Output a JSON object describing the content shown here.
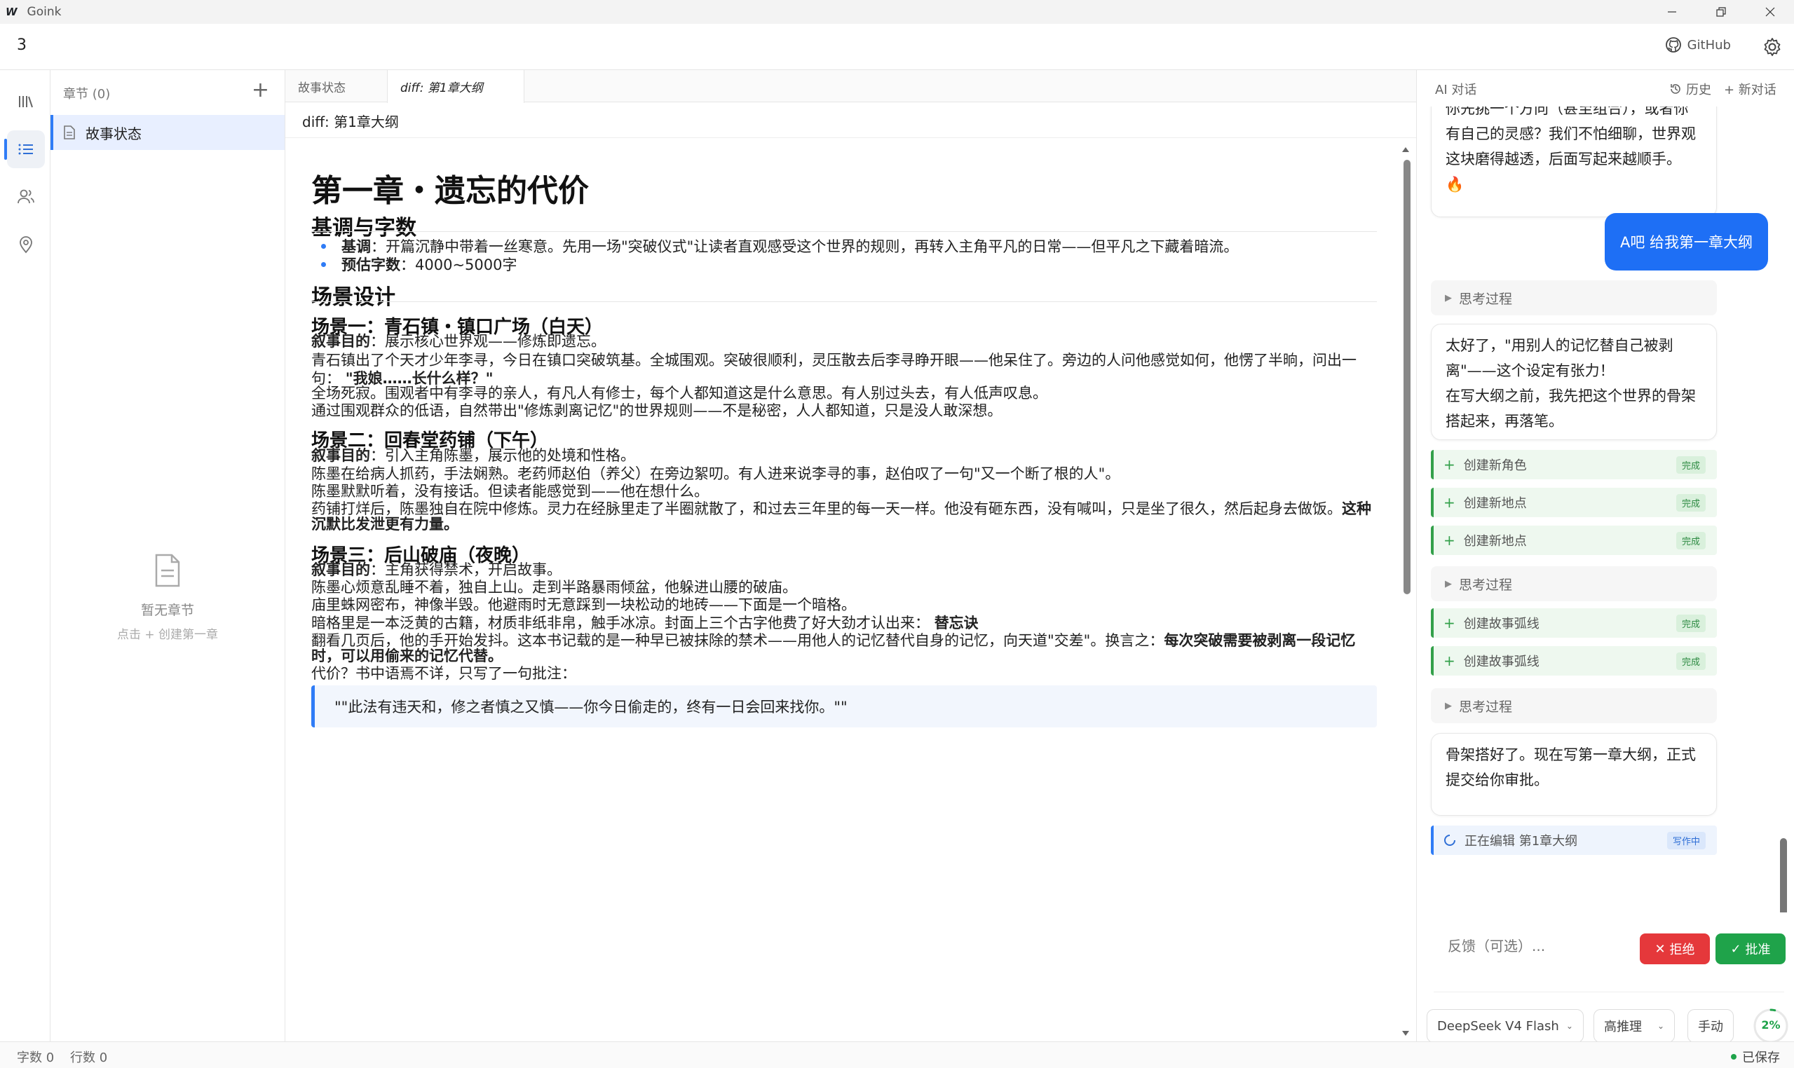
{
  "window": {
    "logo": "W",
    "title": "Goink"
  },
  "topbar": {
    "project": "3",
    "github_label": "GitHub"
  },
  "rail": {
    "items": [
      "library-icon",
      "list-icon",
      "people-icon",
      "location-icon"
    ]
  },
  "chapters": {
    "header": "章节 (0)",
    "add_label": "+",
    "item_label": "故事状态",
    "empty_title": "暂无章节",
    "empty_hint": "点击 + 创建第一章"
  },
  "editor": {
    "tabs": [
      {
        "label": "故事状态"
      },
      {
        "label": "diff: 第1章大纲"
      }
    ],
    "doc_title": "diff: 第1章大纲",
    "h1": "第一章・遗忘的代价",
    "sec1": {
      "title": "基调与字数",
      "bullets": [
        {
          "label": "基调",
          "text": "：开篇沉静中带着一丝寒意。先用一场\"突破仪式\"让读者直观感受这个世界的规则，再转入主角平凡的日常——但平凡之下藏着暗流。"
        },
        {
          "label": "预估字数",
          "text": "：4000~5000字"
        }
      ]
    },
    "sec2": {
      "title": "场景设计"
    },
    "scene1": {
      "title": "场景一：青石镇・镇口广场（白天）",
      "purpose_label": "叙事目的",
      "purpose": "：展示核心世界观——修炼即遗忘。",
      "p1a": "青石镇出了个天才少年李寻，今日在镇口突破筑基。全城围观。突破很顺利，灵压散去后李寻睁开眼——他呆住了。旁边的人问他感觉如何，他愣了半晌，问出一",
      "p1b": "句：",
      "p1quote": "\"我娘……长什么样？\"",
      "p2": "全场死寂。围观者中有李寻的亲人，有凡人有修士，每个人都知道这是什么意思。有人别过头去，有人低声叹息。",
      "p3": "通过围观群众的低语，自然带出\"修炼剥离记忆\"的世界规则——不是秘密，人人都知道，只是没人敢深想。"
    },
    "scene2": {
      "title": "场景二：回春堂药铺（下午）",
      "purpose_label": "叙事目的",
      "purpose": "：引入主角陈墨，展示他的处境和性格。",
      "p1": "陈墨在给病人抓药，手法娴熟。老药师赵伯（养父）在旁边絮叨。有人进来说李寻的事，赵伯叹了一句\"又一个断了根的人\"。",
      "p2": "陈墨默默听着，没有接话。但读者能感觉到——他在想什么。",
      "p3a": "药铺打烊后，陈墨独自在院中修炼。灵力在经脉里走了半圈就散了，和过去三年里的每一天一样。他没有砸东西，没有喊叫，只是坐了很久，然后起身去做饭。",
      "p3b": "这种",
      "p3c": "沉默比发泄更有力量。"
    },
    "scene3": {
      "title": "场景三：后山破庙（夜晚）",
      "purpose_label": "叙事目的",
      "purpose": "：主角获得禁术，开启故事。",
      "p1": "陈墨心烦意乱睡不着，独自上山。走到半路暴雨倾盆，他躲进山腰的破庙。",
      "p2": "庙里蛛网密布，神像半毁。他避雨时无意踩到一块松动的地砖——下面是一个暗格。",
      "p3a": "暗格里是一本泛黄的古籍，材质非纸非帛，触手冰凉。封面上三个古字他费了好大劲才认出来：",
      "p3b": "替忘诀",
      "p4a": "翻看几页后，他的手开始发抖。这本书记载的是一种早已被抹除的禁术——用他人的记忆替代自身的记忆，向天道\"交差\"。换言之：",
      "p4b": "每次突破需要被剥离一段记忆",
      "p4c": "时，可以用偷来的记忆代替。",
      "p5": "代价？书中语焉不详，只写了一句批注：",
      "quote": "\"\"此法有违天和，修之者慎之又慎——你今日偷走的，终有一日会回来找你。\"\""
    }
  },
  "ai": {
    "title": "AI 对话",
    "history": "历史",
    "new_chat": "+ 新对话",
    "msg1": [
      "你先挑一个方向（甚至组合），或者你",
      "有自己的灵感？我们不怕细聊，世界观",
      "这块磨得越透，后面写起来越顺手。"
    ],
    "msg1_emoji": "🔥",
    "user_msg": "A吧 给我第一章大纲",
    "think_label": "思考过程",
    "msg2": [
      "太好了，\"用别人的记忆替自己被剥",
      "离\"——这个设定有张力！",
      "在写大纲之前，我先把这个世界的骨架",
      "搭起来，再落笔。"
    ],
    "tools": [
      {
        "label": "创建新角色",
        "status": "完成"
      },
      {
        "label": "创建新地点",
        "status": "完成"
      },
      {
        "label": "创建新地点",
        "status": "完成"
      },
      {
        "label": "创建故事弧线",
        "status": "完成"
      },
      {
        "label": "创建故事弧线",
        "status": "完成"
      }
    ],
    "msg3": [
      "骨架搭好了。现在写第一章大纲，正式",
      "提交给你审批。"
    ],
    "editing": {
      "label": "正在编辑 第1章大纲",
      "status": "写作中"
    },
    "feedback_placeholder": "反馈（可选）...",
    "reject": "拒绝",
    "approve": "批准",
    "model": "DeepSeek V4 Flash",
    "reasoning": "高推理",
    "mode": "手动",
    "context_pct": "2%",
    "context_fraction": 0.02
  },
  "status": {
    "words": "字数 0",
    "lines": "行数 0",
    "saved": "已保存"
  },
  "colors": {
    "accent": "#2f7cf6",
    "user_bubble": "#1e6ff5",
    "reject": "#e5383b",
    "approve": "#1fa34a"
  }
}
